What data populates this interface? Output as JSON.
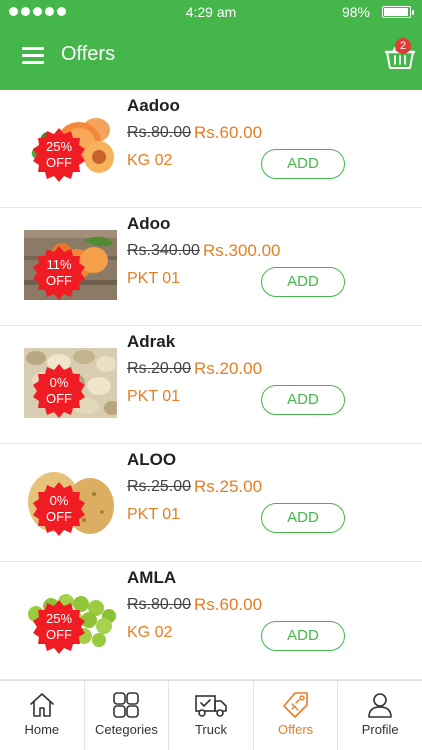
{
  "status_bar": {
    "time": "4:29 am",
    "battery": "98%"
  },
  "header": {
    "title": "Offers",
    "cart_count": "2"
  },
  "colors": {
    "primary": "#45b649",
    "accent": "#e67e22",
    "badge": "#e53935"
  },
  "products": [
    {
      "name": "Aadoo",
      "old_price": "Rs.80.00",
      "new_price": "Rs.60.00",
      "unit": "KG 02",
      "discount": "25%",
      "discount_label": "OFF",
      "add_label": "ADD",
      "image": "peach-icon"
    },
    {
      "name": "Adoo",
      "old_price": "Rs.340.00",
      "new_price": "Rs.300.00",
      "unit": "PKT 01",
      "discount": "11%",
      "discount_label": "OFF",
      "add_label": "ADD",
      "image": "peach-photo"
    },
    {
      "name": "Adrak",
      "old_price": "Rs.20.00",
      "new_price": "Rs.20.00",
      "unit": "PKT 01",
      "discount": "0%",
      "discount_label": "OFF",
      "add_label": "ADD",
      "image": "ginger-photo"
    },
    {
      "name": "ALOO",
      "old_price": "Rs.25.00",
      "new_price": "Rs.25.00",
      "unit": "PKT 01",
      "discount": "0%",
      "discount_label": "OFF",
      "add_label": "ADD",
      "image": "potato-icon"
    },
    {
      "name": "AMLA",
      "old_price": "Rs.80.00",
      "new_price": "Rs.60.00",
      "unit": "KG 02",
      "discount": "25%",
      "discount_label": "OFF",
      "add_label": "ADD",
      "image": "amla-icon"
    }
  ],
  "bottom_nav": [
    {
      "label": "Home",
      "icon": "home-icon"
    },
    {
      "label": "Cetegories",
      "icon": "grid-icon"
    },
    {
      "label": "Truck",
      "icon": "truck-icon"
    },
    {
      "label": "Offers",
      "icon": "offers-tag-icon",
      "active": true
    },
    {
      "label": "Profile",
      "icon": "profile-icon"
    }
  ]
}
